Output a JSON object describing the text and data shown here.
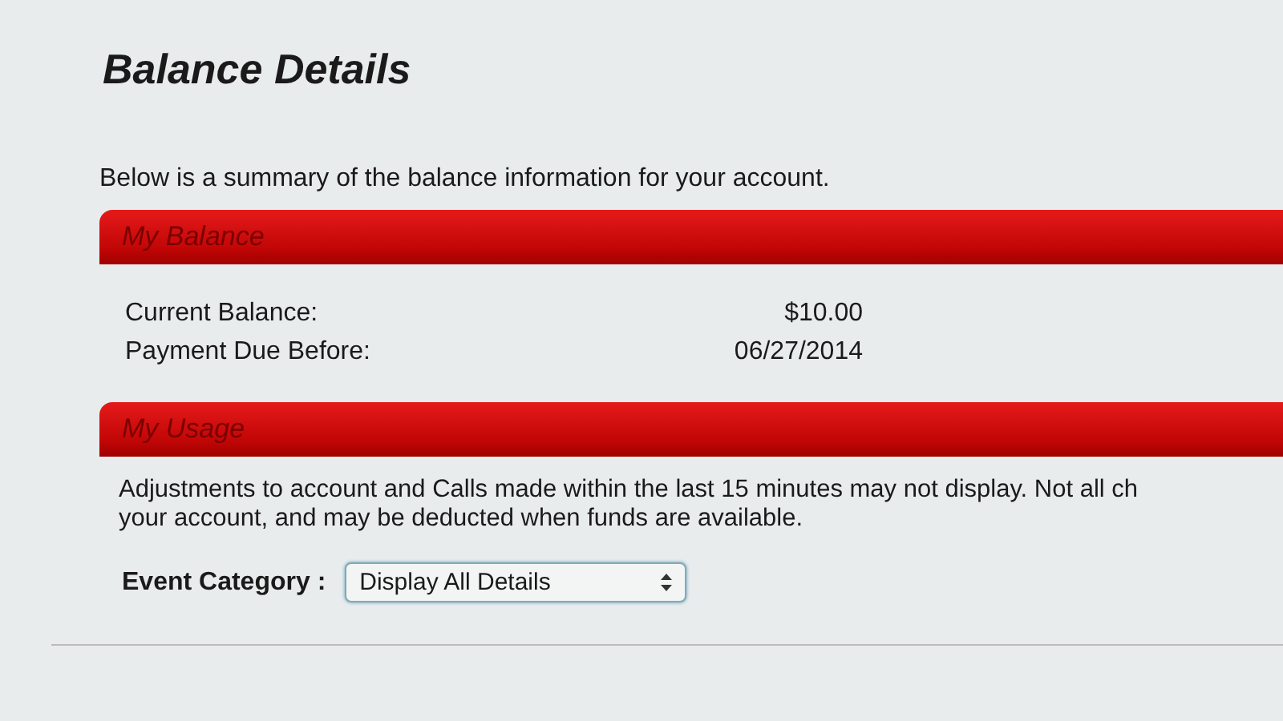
{
  "title": "Balance Details",
  "intro": "Below is a summary of the balance information for your account.",
  "sections": [
    {
      "heading": "My Balance",
      "kind": "fields",
      "fields": [
        {
          "label": "Current Balance:",
          "value": "$10.00"
        },
        {
          "label": "Payment Due Before:",
          "value": "06/27/2014"
        }
      ]
    },
    {
      "heading": "My Usage",
      "kind": "usage",
      "note_lines": [
        "Adjustments to account and Calls made within the last 15 minutes may not display. Not all ch",
        "your account, and may be deducted when funds are available."
      ],
      "filter": {
        "label": "Event Category :",
        "value": "Display All Details"
      }
    }
  ]
}
